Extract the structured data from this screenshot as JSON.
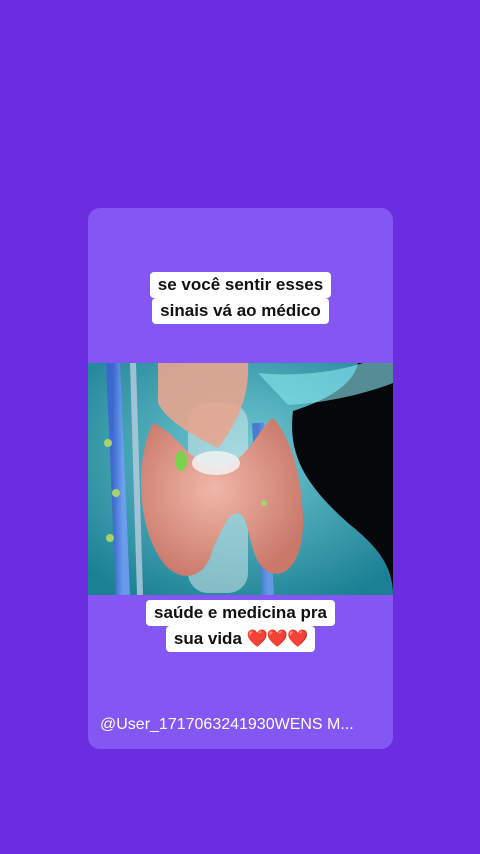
{
  "top_caption": {
    "line1": "se você sentir esses",
    "line2": "sinais vá ao médico"
  },
  "bottom_caption": {
    "line1": "saúde e medicina pra",
    "line2_text": "sua vida ",
    "line2_hearts": "❤️❤️❤️"
  },
  "footer": {
    "username": "@User_1717063241930WENS  M..."
  },
  "colors": {
    "background": "#6a2ddf",
    "card": "#8456f4",
    "caption_bg": "#ffffff"
  },
  "media": {
    "icon": "thyroid-anatomy-illustration"
  }
}
